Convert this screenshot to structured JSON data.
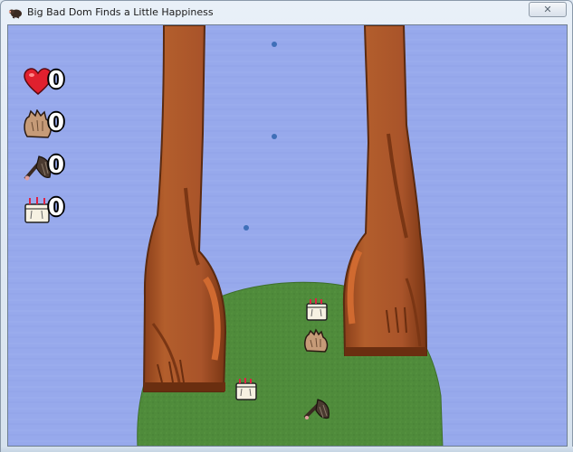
{
  "window": {
    "title": "Big Bad Dom Finds a Little Happiness",
    "close_glyph": "✕",
    "app_icon": "mole-icon"
  },
  "hud": {
    "items": [
      {
        "icon": "heart-icon",
        "count": "0"
      },
      {
        "icon": "glove-icon",
        "count": "0"
      },
      {
        "icon": "shovel-icon",
        "count": "0"
      },
      {
        "icon": "cake-icon",
        "count": "0"
      }
    ]
  },
  "scene": {
    "sky_color": "#97a9ec",
    "hill_color": "#4e8a3a",
    "leg_color": "#a8562a",
    "leg_dark_color": "#7a3a18",
    "pickups": [
      "cake-icon",
      "glove-icon",
      "cake-icon",
      "shovel-icon"
    ]
  }
}
